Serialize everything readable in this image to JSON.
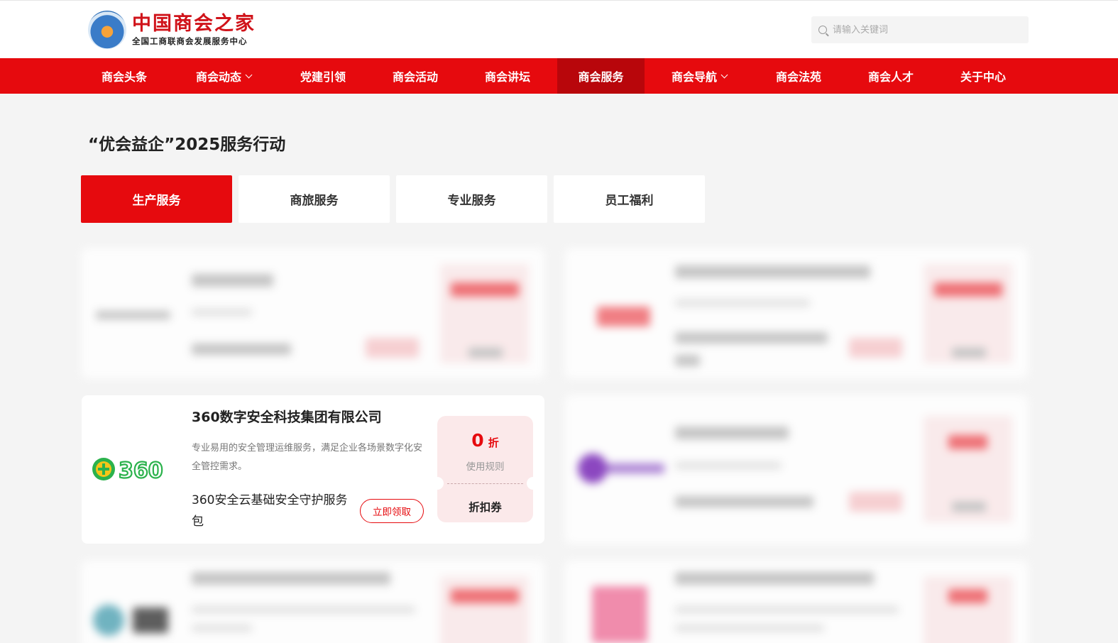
{
  "header": {
    "logo": {
      "title": "中国商会之家",
      "subtitle": "全国工商联商会发展服务中心"
    },
    "search": {
      "placeholder": "请输入关键词"
    }
  },
  "nav": {
    "items": [
      {
        "label": "商会头条",
        "dropdown": false
      },
      {
        "label": "商会动态",
        "dropdown": true
      },
      {
        "label": "党建引领",
        "dropdown": false
      },
      {
        "label": "商会活动",
        "dropdown": false
      },
      {
        "label": "商会讲坛",
        "dropdown": false
      },
      {
        "label": "商会服务",
        "dropdown": false,
        "active": true
      },
      {
        "label": "商会导航",
        "dropdown": true
      },
      {
        "label": "商会法苑",
        "dropdown": false
      },
      {
        "label": "商会人才",
        "dropdown": false
      },
      {
        "label": "关于中心",
        "dropdown": false
      }
    ]
  },
  "page": {
    "title": "“优会益企”2025服务行动",
    "tabs": [
      {
        "label": "生产服务",
        "active": true
      },
      {
        "label": "商旅服务",
        "active": false
      },
      {
        "label": "专业服务",
        "active": false
      },
      {
        "label": "员工福利",
        "active": false
      }
    ]
  },
  "featured_card": {
    "company": "360数字安全科技集团有限公司",
    "logo_text": "360",
    "description": "专业易用的安全管理运维服务，满足企业各场景数字化安全管控需求。",
    "product": "360安全云基础安全守护服务包",
    "claim_button": "立即领取",
    "coupon": {
      "value": "0",
      "unit": "折",
      "rules": "使用规则",
      "type": "折扣券"
    }
  },
  "colors": {
    "brand_red": "#e60a0e",
    "nav_active": "#b8060b",
    "coupon_bg": "#fbe9ea",
    "page_bg": "#f4f4f4"
  }
}
